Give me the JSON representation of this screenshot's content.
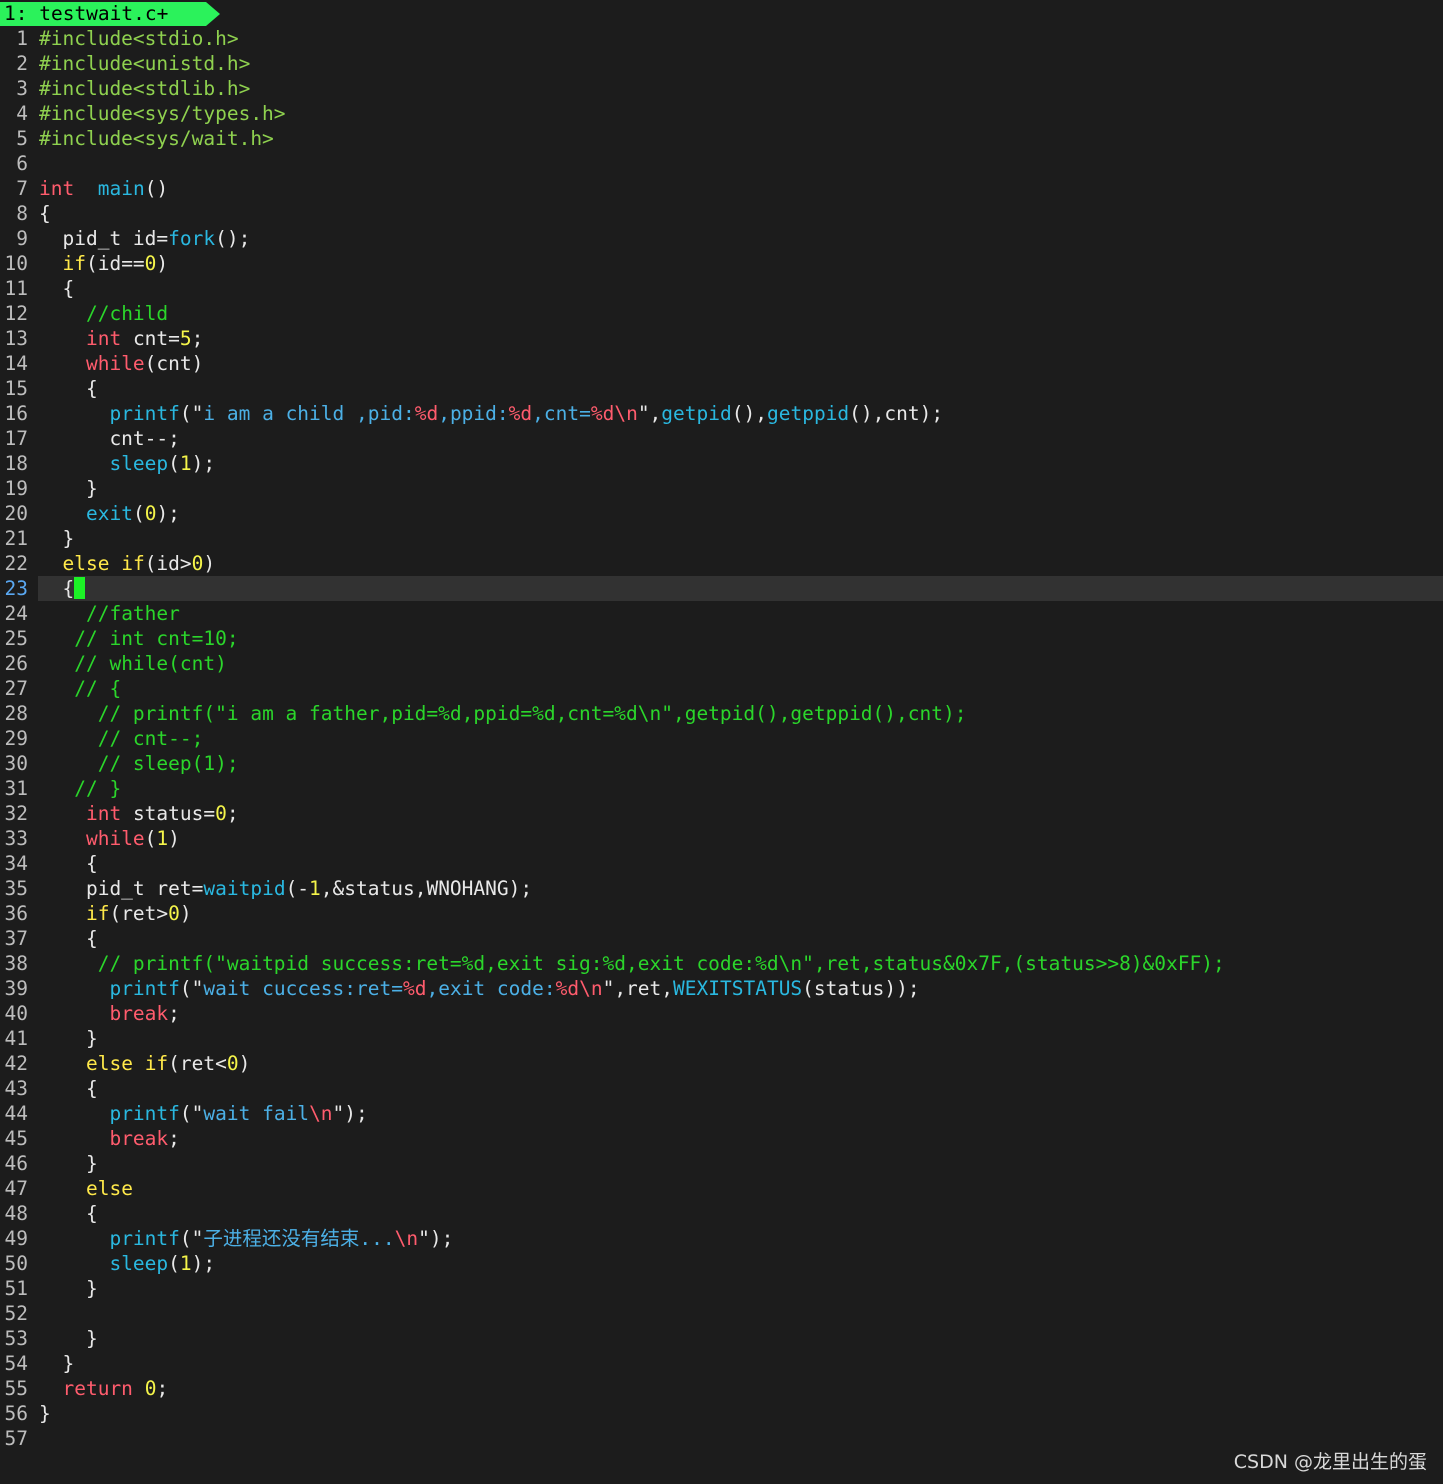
{
  "tab": {
    "label": "1: testwait.c+"
  },
  "cursor_line": 23,
  "lines": [
    {
      "n": "1",
      "t": [
        [
          "inc",
          "#include<stdio.h>"
        ]
      ]
    },
    {
      "n": "2",
      "t": [
        [
          "inc",
          "#include<unistd.h>"
        ]
      ]
    },
    {
      "n": "3",
      "t": [
        [
          "inc",
          "#include<stdlib.h>"
        ]
      ]
    },
    {
      "n": "4",
      "t": [
        [
          "inc",
          "#include<sys/types.h>"
        ]
      ]
    },
    {
      "n": "5",
      "t": [
        [
          "inc",
          "#include<sys/wait.h>"
        ]
      ]
    },
    {
      "n": "6",
      "t": []
    },
    {
      "n": "7",
      "t": [
        [
          "k",
          "int"
        ],
        [
          "",
          "  "
        ],
        [
          "f",
          "main"
        ],
        [
          "",
          "()"
        ]
      ]
    },
    {
      "n": "8",
      "t": [
        [
          "",
          "{"
        ]
      ]
    },
    {
      "n": "9",
      "t": [
        [
          "",
          "  pid_t id="
        ],
        [
          "f",
          "fork"
        ],
        [
          "",
          "();"
        ]
      ]
    },
    {
      "n": "10",
      "t": [
        [
          "",
          "  "
        ],
        [
          "ck",
          "if"
        ],
        [
          "",
          "(id=="
        ],
        [
          "n",
          "0"
        ],
        [
          "",
          ")"
        ]
      ]
    },
    {
      "n": "11",
      "t": [
        [
          "",
          "  {"
        ]
      ]
    },
    {
      "n": "12",
      "t": [
        [
          "",
          "    "
        ],
        [
          "c",
          "//child"
        ]
      ]
    },
    {
      "n": "13",
      "t": [
        [
          "",
          "    "
        ],
        [
          "k",
          "int"
        ],
        [
          "",
          " cnt="
        ],
        [
          "n",
          "5"
        ],
        [
          "",
          ";"
        ]
      ]
    },
    {
      "n": "14",
      "t": [
        [
          "",
          "    "
        ],
        [
          "k",
          "while"
        ],
        [
          "",
          "(cnt)"
        ]
      ]
    },
    {
      "n": "15",
      "t": [
        [
          "",
          "    {"
        ]
      ]
    },
    {
      "n": "16",
      "t": [
        [
          "",
          "      "
        ],
        [
          "f",
          "printf"
        ],
        [
          "",
          "(\""
        ],
        [
          "s",
          "i am a child ,pid:"
        ],
        [
          "fm",
          "%d"
        ],
        [
          "s",
          ",ppid:"
        ],
        [
          "fm",
          "%d"
        ],
        [
          "s",
          ",cnt="
        ],
        [
          "fm",
          "%d"
        ],
        [
          "e",
          "\\n"
        ],
        [
          "",
          "\","
        ],
        [
          "f",
          "getpid"
        ],
        [
          "",
          "(),"
        ],
        [
          "f",
          "getppid"
        ],
        [
          "",
          "(),cnt);"
        ]
      ]
    },
    {
      "n": "17",
      "t": [
        [
          "",
          "      cnt--;"
        ]
      ]
    },
    {
      "n": "18",
      "t": [
        [
          "",
          "      "
        ],
        [
          "f",
          "sleep"
        ],
        [
          "",
          "("
        ],
        [
          "n",
          "1"
        ],
        [
          "",
          ");"
        ]
      ]
    },
    {
      "n": "19",
      "t": [
        [
          "",
          "    }"
        ]
      ]
    },
    {
      "n": "20",
      "t": [
        [
          "",
          "    "
        ],
        [
          "f",
          "exit"
        ],
        [
          "",
          "("
        ],
        [
          "n",
          "0"
        ],
        [
          "",
          ");"
        ]
      ]
    },
    {
      "n": "21",
      "t": [
        [
          "",
          "  }"
        ]
      ]
    },
    {
      "n": "22",
      "t": [
        [
          "",
          "  "
        ],
        [
          "ck",
          "else"
        ],
        [
          "",
          " "
        ],
        [
          "ck",
          "if"
        ],
        [
          "",
          "(id>"
        ],
        [
          "n",
          "0"
        ],
        [
          "",
          ")"
        ]
      ]
    },
    {
      "n": "23",
      "t": [
        [
          "",
          "  {"
        ],
        [
          "cursor",
          ""
        ]
      ]
    },
    {
      "n": "24",
      "t": [
        [
          "",
          "    "
        ],
        [
          "c",
          "//father"
        ]
      ]
    },
    {
      "n": "25",
      "t": [
        [
          "",
          "   "
        ],
        [
          "c",
          "// int cnt=10;"
        ]
      ]
    },
    {
      "n": "26",
      "t": [
        [
          "",
          "   "
        ],
        [
          "c",
          "// while(cnt)"
        ]
      ]
    },
    {
      "n": "27",
      "t": [
        [
          "",
          "   "
        ],
        [
          "c",
          "// {"
        ]
      ]
    },
    {
      "n": "28",
      "t": [
        [
          "",
          "     "
        ],
        [
          "c",
          "// printf(\"i am a father,pid=%d,ppid=%d,cnt=%d\\n\",getpid(),getppid(),cnt);"
        ]
      ]
    },
    {
      "n": "29",
      "t": [
        [
          "",
          "     "
        ],
        [
          "c",
          "// cnt--;"
        ]
      ]
    },
    {
      "n": "30",
      "t": [
        [
          "",
          "     "
        ],
        [
          "c",
          "// sleep(1);"
        ]
      ]
    },
    {
      "n": "31",
      "t": [
        [
          "",
          "   "
        ],
        [
          "c",
          "// }"
        ]
      ]
    },
    {
      "n": "32",
      "t": [
        [
          "",
          "    "
        ],
        [
          "k",
          "int"
        ],
        [
          "",
          " status="
        ],
        [
          "n",
          "0"
        ],
        [
          "",
          ";"
        ]
      ]
    },
    {
      "n": "33",
      "t": [
        [
          "",
          "    "
        ],
        [
          "k",
          "while"
        ],
        [
          "",
          "("
        ],
        [
          "n",
          "1"
        ],
        [
          "",
          ")"
        ]
      ]
    },
    {
      "n": "34",
      "t": [
        [
          "",
          "    {"
        ]
      ]
    },
    {
      "n": "35",
      "t": [
        [
          "",
          "    pid_t ret="
        ],
        [
          "f",
          "waitpid"
        ],
        [
          "",
          "(-"
        ],
        [
          "n",
          "1"
        ],
        [
          "",
          ",&status,WNOHANG);"
        ]
      ]
    },
    {
      "n": "36",
      "t": [
        [
          "",
          "    "
        ],
        [
          "ck",
          "if"
        ],
        [
          "",
          "(ret>"
        ],
        [
          "n",
          "0"
        ],
        [
          "",
          ")"
        ]
      ]
    },
    {
      "n": "37",
      "t": [
        [
          "",
          "    {"
        ]
      ]
    },
    {
      "n": "38",
      "t": [
        [
          "",
          "     "
        ],
        [
          "c",
          "// printf(\"waitpid success:ret=%d,exit sig:%d,exit code:%d\\n\",ret,status&0x7F,(status>>8)&0xFF);"
        ]
      ]
    },
    {
      "n": "39",
      "t": [
        [
          "",
          "      "
        ],
        [
          "f",
          "printf"
        ],
        [
          "",
          "(\""
        ],
        [
          "s",
          "wait cuccess:ret="
        ],
        [
          "fm",
          "%d"
        ],
        [
          "s",
          ",exit code:"
        ],
        [
          "fm",
          "%d"
        ],
        [
          "e",
          "\\n"
        ],
        [
          "",
          "\",ret,"
        ],
        [
          "f",
          "WEXITSTATUS"
        ],
        [
          "",
          "(status));"
        ]
      ]
    },
    {
      "n": "40",
      "t": [
        [
          "",
          "      "
        ],
        [
          "k",
          "break"
        ],
        [
          "",
          ";"
        ]
      ]
    },
    {
      "n": "41",
      "t": [
        [
          "",
          "    }"
        ]
      ]
    },
    {
      "n": "42",
      "t": [
        [
          "",
          "    "
        ],
        [
          "ck",
          "else"
        ],
        [
          "",
          " "
        ],
        [
          "ck",
          "if"
        ],
        [
          "",
          "(ret<"
        ],
        [
          "n",
          "0"
        ],
        [
          "",
          ")"
        ]
      ]
    },
    {
      "n": "43",
      "t": [
        [
          "",
          "    {"
        ]
      ]
    },
    {
      "n": "44",
      "t": [
        [
          "",
          "      "
        ],
        [
          "f",
          "printf"
        ],
        [
          "",
          "(\""
        ],
        [
          "s",
          "wait fail"
        ],
        [
          "e",
          "\\n"
        ],
        [
          "",
          "\");"
        ]
      ]
    },
    {
      "n": "45",
      "t": [
        [
          "",
          "      "
        ],
        [
          "k",
          "break"
        ],
        [
          "",
          ";"
        ]
      ]
    },
    {
      "n": "46",
      "t": [
        [
          "",
          "    }"
        ]
      ]
    },
    {
      "n": "47",
      "t": [
        [
          "",
          "    "
        ],
        [
          "ck",
          "else"
        ]
      ]
    },
    {
      "n": "48",
      "t": [
        [
          "",
          "    {"
        ]
      ]
    },
    {
      "n": "49",
      "t": [
        [
          "",
          "      "
        ],
        [
          "f",
          "printf"
        ],
        [
          "",
          "(\""
        ],
        [
          "s",
          "子进程还没有结束..."
        ],
        [
          "e",
          "\\n"
        ],
        [
          "",
          "\");"
        ]
      ]
    },
    {
      "n": "50",
      "t": [
        [
          "",
          "      "
        ],
        [
          "f",
          "sleep"
        ],
        [
          "",
          "("
        ],
        [
          "n",
          "1"
        ],
        [
          "",
          ");"
        ]
      ]
    },
    {
      "n": "51",
      "t": [
        [
          "",
          "    }"
        ]
      ]
    },
    {
      "n": "52",
      "t": []
    },
    {
      "n": "53",
      "t": [
        [
          "",
          "    }"
        ]
      ]
    },
    {
      "n": "54",
      "t": [
        [
          "",
          "  }"
        ]
      ]
    },
    {
      "n": "55",
      "t": [
        [
          "",
          "  "
        ],
        [
          "k",
          "return"
        ],
        [
          "",
          " "
        ],
        [
          "n",
          "0"
        ],
        [
          "",
          ";"
        ]
      ]
    },
    {
      "n": "56",
      "t": [
        [
          "",
          "}"
        ]
      ]
    },
    {
      "n": "57",
      "t": []
    }
  ],
  "watermark": "CSDN @龙里出生的蛋"
}
